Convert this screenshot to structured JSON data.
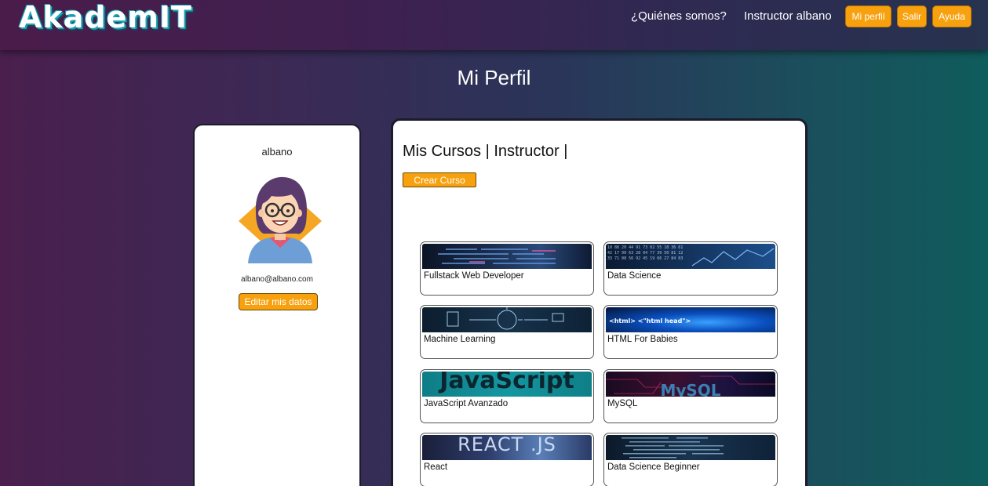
{
  "navbar": {
    "logo": "AkademIT",
    "links": [
      "¿Quiénes somos?",
      "Instructor albano"
    ],
    "buttons": [
      "Mi perfil",
      "Salir",
      "Ayuda"
    ]
  },
  "page": {
    "title": "Mi Perfil"
  },
  "profile": {
    "name": "albano",
    "email": "albano@albano.com",
    "edit_label": "Editar mis datos"
  },
  "courses": {
    "title": "Mis Cursos | Instructor |",
    "create_label": "Crear Curso",
    "items": [
      {
        "name": "Fullstack Web Developer",
        "thumb": "code-screen"
      },
      {
        "name": "Data Science",
        "thumb": "data-screen"
      },
      {
        "name": "Machine Learning",
        "thumb": "ml-icons"
      },
      {
        "name": "HTML For Babies",
        "thumb": "html-blue",
        "thumb_text": "<html>  <\"html head\">"
      },
      {
        "name": "JavaScript Avanzado",
        "thumb": "js-banner",
        "thumb_text": "JavaScript"
      },
      {
        "name": "MySQL",
        "thumb": "mysql-banner",
        "thumb_text": "MySQL"
      },
      {
        "name": "React",
        "thumb": "react-banner",
        "thumb_text": "REACT .JS"
      },
      {
        "name": "Data Science Beginner",
        "thumb": "code-screen-2"
      }
    ]
  },
  "colors": {
    "accent": "#f7a10f",
    "nav_bg": "#3d2150",
    "card_bg": "#ffffff"
  }
}
